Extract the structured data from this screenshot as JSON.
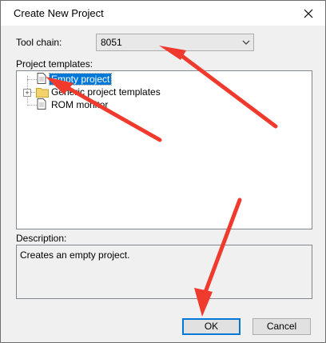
{
  "dialog": {
    "title": "Create New Project",
    "close_glyph": "✕"
  },
  "toolchain": {
    "label": "Tool chain:",
    "selected": "8051"
  },
  "templates": {
    "label": "Project templates:",
    "items": [
      {
        "label": "Empty project",
        "selected": true,
        "icon": "document-icon"
      },
      {
        "label": "Generic project templates",
        "selected": false,
        "icon": "folder-icon",
        "expandable": true
      },
      {
        "label": "ROM monitor",
        "selected": false,
        "icon": "document-icon"
      }
    ]
  },
  "description": {
    "label": "Description:",
    "text": "Creates an empty project."
  },
  "buttons": {
    "ok": "OK",
    "cancel": "Cancel"
  },
  "colors": {
    "accent": "#0078d7",
    "annotation_arrow": "#f03a2e"
  }
}
